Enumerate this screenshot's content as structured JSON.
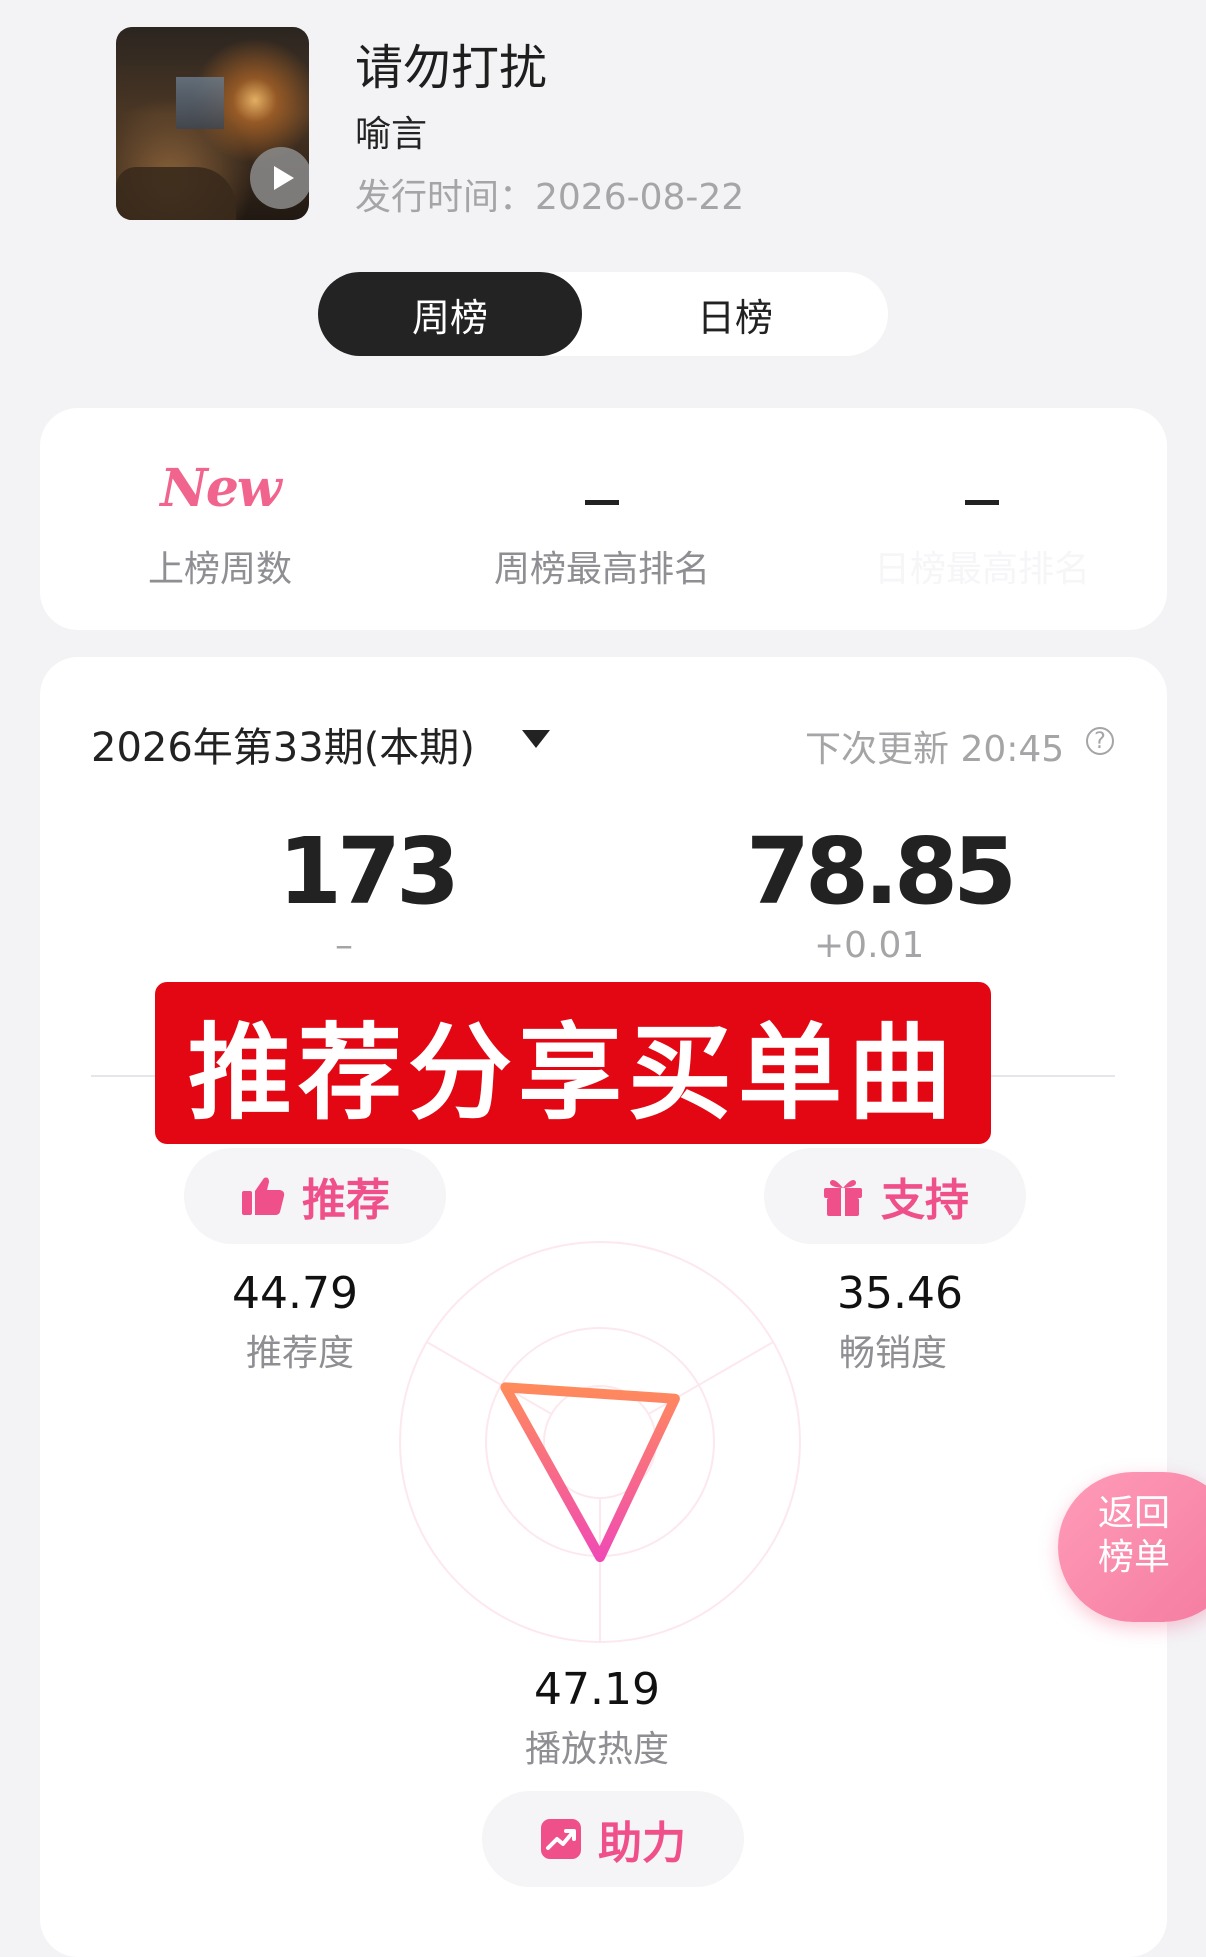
{
  "song": {
    "title": "请勿打扰",
    "artist": "喻言",
    "release": "发行时间：2026-08-22"
  },
  "tabs": {
    "week": "周榜",
    "day": "日榜",
    "active": "周榜"
  },
  "stats": [
    {
      "value": "New",
      "label": "上榜周数"
    },
    {
      "value": "-",
      "label": "周榜最高排名"
    },
    {
      "value": "-",
      "label": "日榜最高排名"
    }
  ],
  "period": {
    "label": "2026年第33期(本期)",
    "next_update": "下次更新 20:45",
    "help": "?"
  },
  "ranking": {
    "rank": "173",
    "rank_change": "–",
    "score": "78.85",
    "score_change": "+0.01"
  },
  "banner": "推荐分享买单曲",
  "metrics": {
    "recommend": {
      "button": "推荐",
      "value": "44.79",
      "label": "推荐度"
    },
    "support": {
      "button": "支持",
      "value": "35.46",
      "label": "畅销度"
    },
    "boost": {
      "button": "助力",
      "value": "47.19",
      "label": "播放热度"
    }
  },
  "radar_values": {
    "recommend": 44.79,
    "sales": 35.46,
    "play": 47.19,
    "max": 100
  },
  "return_button": "返回\n榜单",
  "colors": {
    "accent": "#f0508a",
    "banner": "#e30613",
    "tab_active": "#232323"
  },
  "icons": [
    "play-icon",
    "caret-down-icon",
    "help-icon",
    "thumbs-up-icon",
    "gift-icon",
    "trend-icon"
  ]
}
